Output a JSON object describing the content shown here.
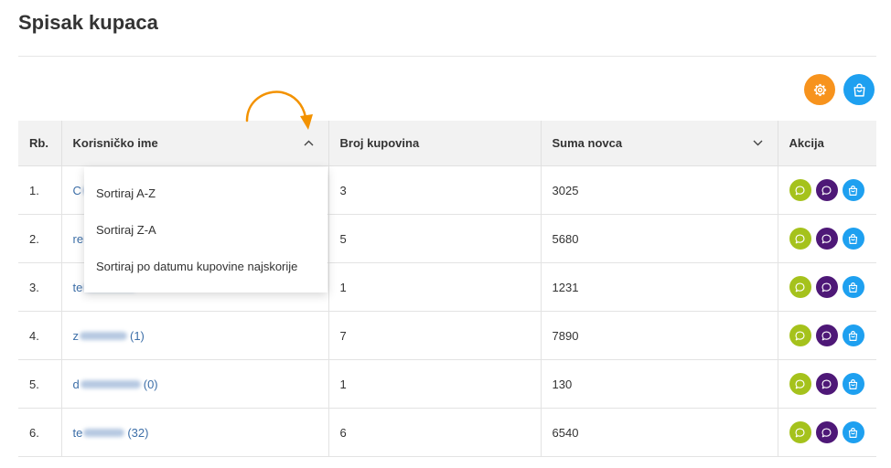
{
  "page": {
    "title": "Spisak kupaca"
  },
  "toolbar": {
    "settings_button": {
      "icon": "gear-icon"
    },
    "bag_button": {
      "icon": "shopping-bag-icon"
    }
  },
  "colors": {
    "link": "#3d6fa8",
    "annotation_orange": "#f39200",
    "settings_orange": "#f7931d",
    "action_green": "#a5c21c",
    "action_purple": "#4e1877",
    "action_blue": "#1ea0f0",
    "header_bg": "#f2f2f2"
  },
  "table": {
    "headers": {
      "index": "Rb.",
      "username": "Korisničko ime",
      "purchases": "Broj kupovina",
      "amount": "Suma novca",
      "actions": "Akcija"
    },
    "sort_icons": {
      "username": "chevron-up-icon",
      "amount": "chevron-down-icon"
    },
    "row_action_icons": [
      "chat-bubble-icon",
      "chat-bubble-icon",
      "shopping-bag-icon"
    ],
    "rows": [
      {
        "index": "1.",
        "username_start": "C",
        "username_blurred": true,
        "purchases": "3",
        "amount": "3025"
      },
      {
        "index": "2.",
        "username_start": "re",
        "username_blurred": true,
        "purchases": "5",
        "amount": "5680"
      },
      {
        "index": "3.",
        "username_start": "te",
        "username_blurred": true,
        "purchases": "1",
        "amount": "1231"
      },
      {
        "index": "4.",
        "username_start": "z",
        "username_blurred": true,
        "username_count": "(1)",
        "purchases": "7",
        "amount": "7890"
      },
      {
        "index": "5.",
        "username_start": "d",
        "username_blurred": true,
        "username_count": "(0)",
        "purchases": "1",
        "amount": "130"
      },
      {
        "index": "6.",
        "username_start": "te",
        "username_blurred": true,
        "username_count": "(32)",
        "purchases": "6",
        "amount": "6540"
      }
    ]
  },
  "sort_menu": {
    "open": true,
    "items": [
      "Sortiraj A-Z",
      "Sortiraj Z-A",
      "Sortiraj po datumu kupovine najskorije"
    ]
  }
}
